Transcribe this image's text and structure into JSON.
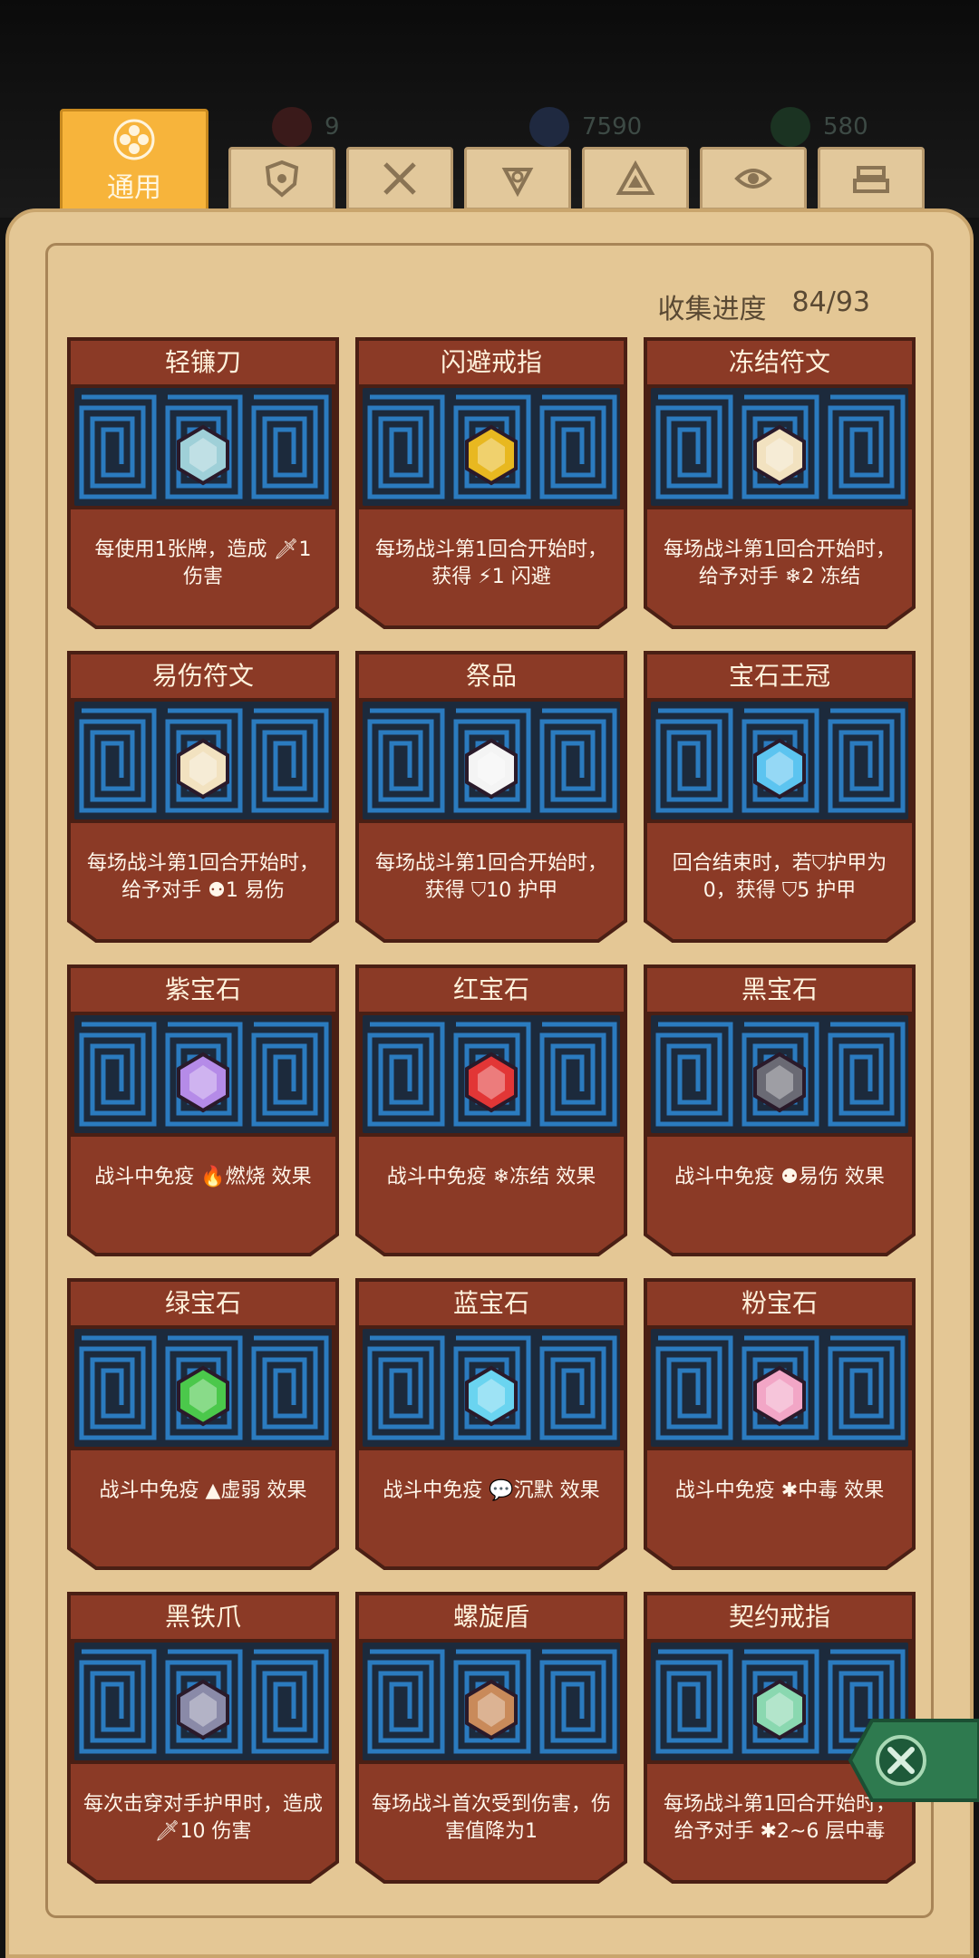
{
  "stats": [
    {
      "value": "9",
      "color": "#6a2a2a"
    },
    {
      "value": "7590",
      "color": "#2a3550"
    },
    {
      "value": "580",
      "color": "#20402a"
    }
  ],
  "tabs": [
    {
      "label": "通用",
      "icon": "clover-icon"
    },
    {
      "icon": "shield-icon"
    },
    {
      "icon": "swords-icon"
    },
    {
      "icon": "spiral-icon"
    },
    {
      "icon": "triangle-icon"
    },
    {
      "icon": "eye-icon"
    },
    {
      "icon": "bricks-icon"
    }
  ],
  "progress": {
    "label": "收集进度",
    "value": "84/93"
  },
  "cards": [
    {
      "name": "轻镰刀",
      "desc": "每使用1张牌，造成 🗡1 伤害",
      "icon": "scythe-blade-icon"
    },
    {
      "name": "闪避戒指",
      "desc": "每场战斗第1回合开始时，获得 ⚡1 闪避",
      "icon": "ring-icon"
    },
    {
      "name": "冻结符文",
      "desc": "每场战斗第1回合开始时，给予对手 ❄2 冻结",
      "icon": "scroll-icon"
    },
    {
      "name": "易伤符文",
      "desc": "每场战斗第1回合开始时，给予对手 ⚉1 易伤",
      "icon": "scroll-icon"
    },
    {
      "name": "祭品",
      "desc": "每场战斗第1回合开始时，获得 ⛉10 护甲",
      "icon": "skull-icon"
    },
    {
      "name": "宝石王冠",
      "desc": "回合结束时，若⛉护甲为0，获得 ⛉5 护甲",
      "icon": "crown-icon"
    },
    {
      "name": "紫宝石",
      "desc": "战斗中免疫 🔥燃烧 效果",
      "icon": "purple-gem-icon"
    },
    {
      "name": "红宝石",
      "desc": "战斗中免疫 ❄冻结 效果",
      "icon": "red-gem-icon"
    },
    {
      "name": "黑宝石",
      "desc": "战斗中免疫 ⚉易伤 效果",
      "icon": "black-gem-icon"
    },
    {
      "name": "绿宝石",
      "desc": "战斗中免疫 ▲虚弱 效果",
      "icon": "green-gem-icon"
    },
    {
      "name": "蓝宝石",
      "desc": "战斗中免疫 💬沉默 效果",
      "icon": "blue-gem-icon"
    },
    {
      "name": "粉宝石",
      "desc": "战斗中免疫 ✱中毒 效果",
      "icon": "pink-gem-icon"
    },
    {
      "name": "黑铁爪",
      "desc": "每次击穿对手护甲时，造成 🗡10 伤害",
      "icon": "claw-icon"
    },
    {
      "name": "螺旋盾",
      "desc": "每场战斗首次受到伤害，伤害值降为1",
      "icon": "spiral-shield-icon"
    },
    {
      "name": "契约戒指",
      "desc": "每场战斗第1回合开始时，给予对手 ✱2~6 层中毒",
      "icon": "leaf-ring-icon"
    }
  ]
}
